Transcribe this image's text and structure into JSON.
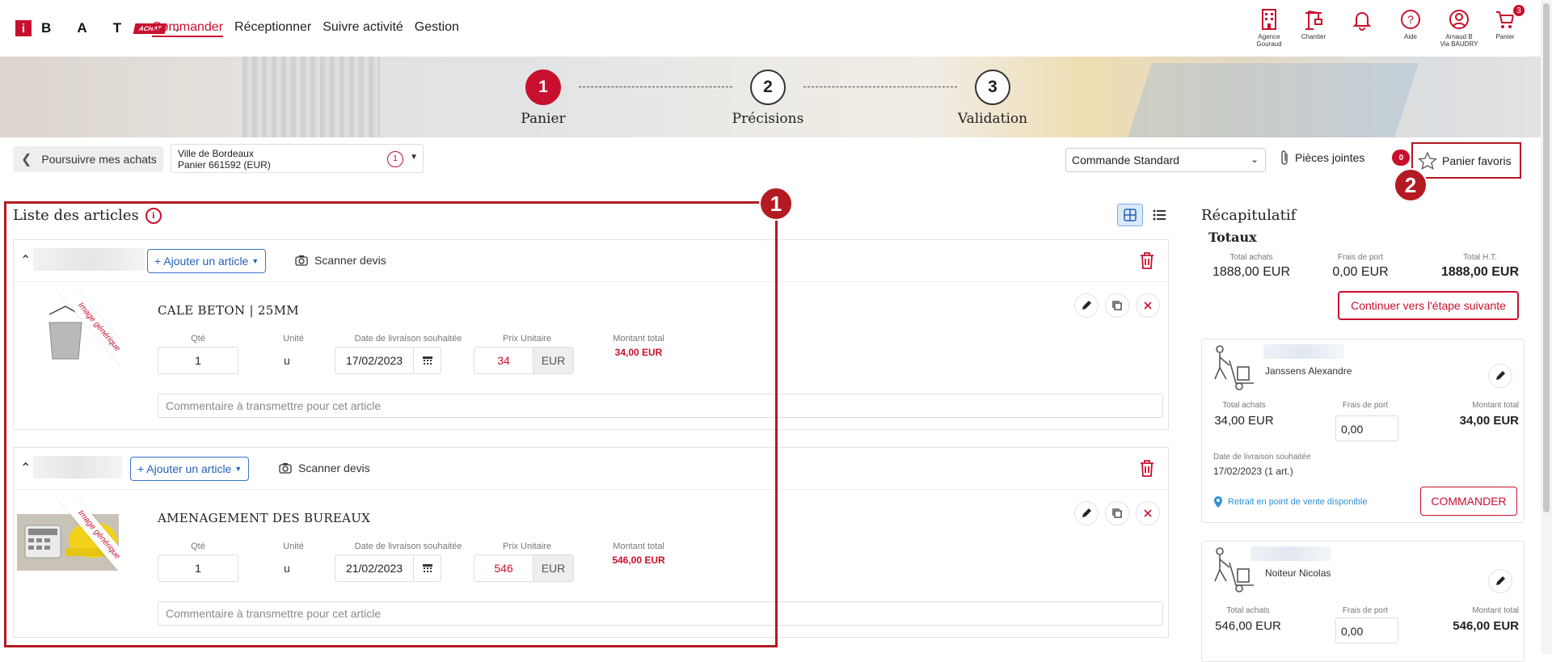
{
  "brand": {
    "letters": "B A T",
    "mark": "i",
    "tag": "ACHAT"
  },
  "nav": {
    "items": [
      {
        "label": "Commander",
        "active": true
      },
      {
        "label": "Réceptionner"
      },
      {
        "label": "Suivre activité"
      },
      {
        "label": "Gestion"
      }
    ]
  },
  "top_icons": {
    "agence": {
      "line1": "Agence",
      "line2": "Gouraud"
    },
    "chantier": "Chantier",
    "aide": "Aide",
    "user": {
      "line1": "Arnaud B",
      "line2": "Via BAUDRY"
    },
    "panier": "Panier",
    "panier_badge": "3"
  },
  "steps": [
    {
      "num": "1",
      "label": "Panier",
      "active": true
    },
    {
      "num": "2",
      "label": "Précisions"
    },
    {
      "num": "3",
      "label": "Validation"
    }
  ],
  "toolbar": {
    "back": "Poursuivre mes achats",
    "panier_line1": "Ville de Bordeaux",
    "panier_line2": "Panier 661592 (EUR)",
    "panier_count": "1",
    "commande_type": "Commande Standard",
    "pieces": "Pièces jointes",
    "pieces_count": "0",
    "favoris": "Panier favoris"
  },
  "callouts": {
    "one": "1",
    "two": "2"
  },
  "list": {
    "title": "Liste des articles",
    "groups": [
      {
        "add_label": "+ Ajouter un article",
        "scan_label": "Scanner devis",
        "article": {
          "ribbon": "Image générique",
          "title": "CALE BETON | 25MM",
          "qty_label": "Qté",
          "qty": "1",
          "unit_label": "Unité",
          "unit": "u",
          "date_label": "Date de livraison souhaitée",
          "date": "17/02/2023",
          "price_label": "Prix Unitaire",
          "price": "34",
          "currency": "EUR",
          "total_label": "Montant total",
          "total": "34,00 EUR",
          "comment_placeholder": "Commentaire à transmettre pour cet article"
        }
      },
      {
        "add_label": "+ Ajouter un article",
        "scan_label": "Scanner devis",
        "article": {
          "ribbon": "Image générique",
          "title": "AMENAGEMENT DES BUREAUX",
          "qty_label": "Qté",
          "qty": "1",
          "unit_label": "Unité",
          "unit": "u",
          "date_label": "Date de livraison souhaitée",
          "date": "21/02/2023",
          "price_label": "Prix Unitaire",
          "price": "546",
          "currency": "EUR",
          "total_label": "Montant total",
          "total": "546,00 EUR",
          "comment_placeholder": "Commentaire à transmettre pour cet article"
        }
      }
    ]
  },
  "recap": {
    "title": "Récapitulatif",
    "totaux": "Totaux",
    "total_achats_label": "Total achats",
    "total_achats": "1888,00 EUR",
    "frais_label": "Frais de port",
    "frais": "0,00 EUR",
    "total_ht_label": "Total H.T.",
    "total_ht": "1888,00 EUR",
    "next": "Continuer vers l'étape suivante",
    "suppliers": [
      {
        "name": "Janssens Alexandre",
        "total_achats_label": "Total achats",
        "total_achats": "34,00 EUR",
        "frais_label": "Frais de port",
        "frais": "0,00",
        "montant_label": "Montant total",
        "montant": "34,00 EUR",
        "date_label": "Date de livraison souhaitée",
        "date": "17/02/2023 (1 art.)",
        "retrait": "Retrait en point de vente disponible",
        "commander": "COMMANDER"
      },
      {
        "name": "Noiteur Nicolas",
        "total_achats_label": "Total achats",
        "total_achats": "546,00 EUR",
        "frais_label": "Frais de port",
        "frais": "0,00",
        "montant_label": "Montant total",
        "montant": "546,00 EUR"
      }
    ]
  },
  "colors": {
    "brand_red": "#c8102e",
    "link_blue": "#2461b8"
  }
}
